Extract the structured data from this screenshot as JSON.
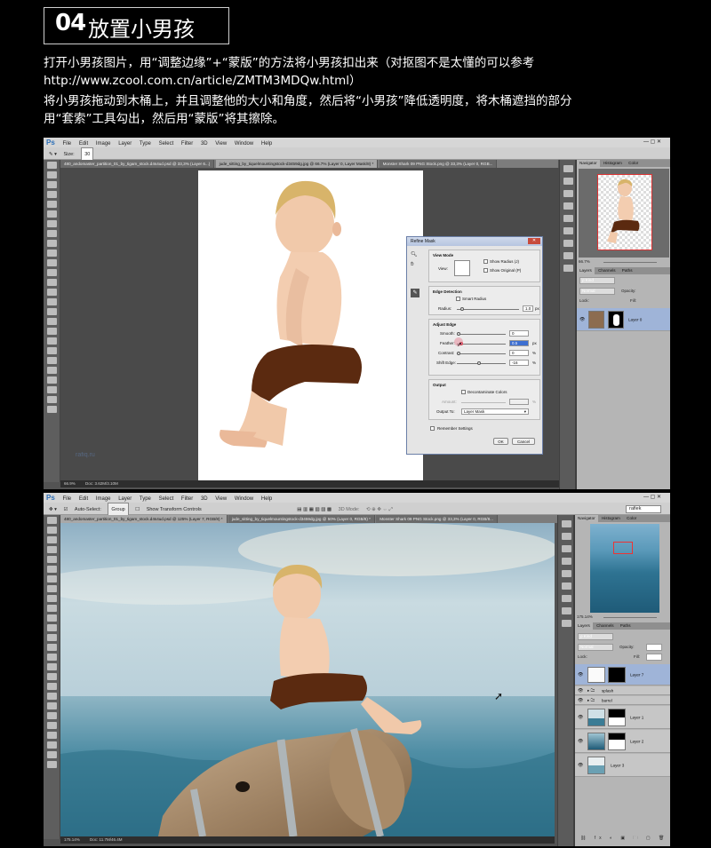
{
  "header": {
    "step": "04",
    "title": "放置小男孩"
  },
  "intro": {
    "line1": "打开小男孩图片，用“调整边缘”+“蒙版”的方法将小男孩扣出来（对抠图不是太懂的可以参考",
    "line2": "http://www.zcool.com.cn/article/ZMTM3MDQw.html）",
    "line3": "将小男孩拖动到木桶上，并且调整他的大小和角度，然后将“小男孩”降低透明度，将木桶遮挡的部分",
    "line4": "用“套索”工具勾出，然后用“蒙版”将其擦除。"
  },
  "ps_menu": {
    "logo": "Ps",
    "items": [
      "File",
      "Edit",
      "Image",
      "Layer",
      "Type",
      "Select",
      "Filter",
      "3D",
      "View",
      "Window",
      "Help"
    ],
    "window_controls": "—  ▢  ✕"
  },
  "shot1": {
    "options": {
      "size_label": "Size:",
      "size_value": "30"
    },
    "workspace": "",
    "tabs": [
      "480_andomaster_partition_01_by_tigam_stock.d4s4ud.psd @ 33,3% (Layer 6...)",
      "jude_sitting_by_tiquelmountingstock-d3459dg.jpg @ 66.7% (Layer 0, Layer Mask/8) *",
      "Monster Shark 09 PNG Stock.png @ 33,3% (Layer 0, RGB..."
    ],
    "status": {
      "zoom": "66.9%",
      "doc": "Doc: 3.62M/3.10M"
    },
    "watermark": "rafiq.ru",
    "navigator_zoom": "66.7%",
    "panel_tabs": [
      "Navigator",
      "Histogram",
      "Color"
    ],
    "layers_tabs": [
      "Layers",
      "Channels",
      "Paths"
    ],
    "kind_label": "ρ Kind",
    "blend_mode": "Normal",
    "opacity_label": "Opacity:",
    "lock_label": "Lock:",
    "fill_label": "Fill:",
    "layers": [
      {
        "name": "Layer 0"
      }
    ],
    "dialog": {
      "title": "Refine Mask",
      "view_mode": "View Mode",
      "view_label": "View:",
      "show_radius": "Show Radius (J)",
      "show_original": "Show Original (P)",
      "edge_detection": "Edge Detection",
      "smart_radius": "Smart Radius",
      "radius_label": "Radius:",
      "radius_value": "1.0",
      "radius_unit": "px",
      "adjust_edge": "Adjust Edge",
      "smooth_label": "Smooth:",
      "smooth_value": "0",
      "feather_label": "Feather:",
      "feather_value": "0.5",
      "feather_unit": "px",
      "contrast_label": "Contrast:",
      "contrast_value": "0",
      "contrast_unit": "%",
      "shift_label": "Shift Edge:",
      "shift_value": "-16",
      "shift_unit": "%",
      "output": "Output",
      "decontaminate": "Decontaminate Colors",
      "amount_label": "Amount:",
      "amount_unit": "%",
      "output_to_label": "Output To:",
      "output_to_value": "Layer Mask",
      "remember": "Remember Settings",
      "ok": "OK",
      "cancel": "Cancel",
      "radius_pos": 0.05,
      "smooth_pos": 0.0,
      "feather_pos": 0.05,
      "contrast_pos": 0.0,
      "shift_pos": 0.42
    }
  },
  "shot2": {
    "options": {
      "auto_select": "Auto-Select:",
      "auto_select_value": "Group",
      "transform": "Show Transform Controls",
      "mode3d": "3D Mode:"
    },
    "workspace": "rafiek",
    "tabs": [
      "480_andomaster_partition_01_by_tigam_stock.d4s4ud.psd @ 125% (Layer 7, RGB/8) *",
      "jude_sitting_by_tiquelmountingstock-d3459dg.jpg @ 50% (Layer 0, RGB/8) *",
      "Monster Shark 09 PNG Stock.png @ 33,3% (Layer 0, RGB/8..."
    ],
    "status": {
      "zoom": "175.14%",
      "doc": "Doc: 11.7M/46.4M"
    },
    "navigator_zoom": "175.14%",
    "panel_tabs": [
      "Navigator",
      "Histogram",
      "Color"
    ],
    "layers_tabs": [
      "Layers",
      "Channels",
      "Paths"
    ],
    "kind_label": "ρ Kind",
    "blend_mode": "Normal",
    "opacity_label": "Opacity:",
    "opacity_value": "100%",
    "lock_label": "Lock:",
    "fill_label": "Fill:",
    "fill_value": "100%",
    "layers": [
      {
        "name": "Layer 7",
        "type": "mask-layer",
        "selected": true
      },
      {
        "name": "splash",
        "type": "group"
      },
      {
        "name": "barrel",
        "type": "group"
      },
      {
        "name": "Layer 1",
        "type": "mask-layer"
      },
      {
        "name": "Layer 2",
        "type": "mask-layer"
      },
      {
        "name": "Layer 3",
        "type": "layer"
      }
    ]
  },
  "colors": {
    "ps_bg": "#535353",
    "sky": "#b9d2dd",
    "sea": "#2d6d86",
    "shorts": "#5b2a10",
    "barrel": "#9e7e5d",
    "selected_layer": "#9fb4d8"
  }
}
